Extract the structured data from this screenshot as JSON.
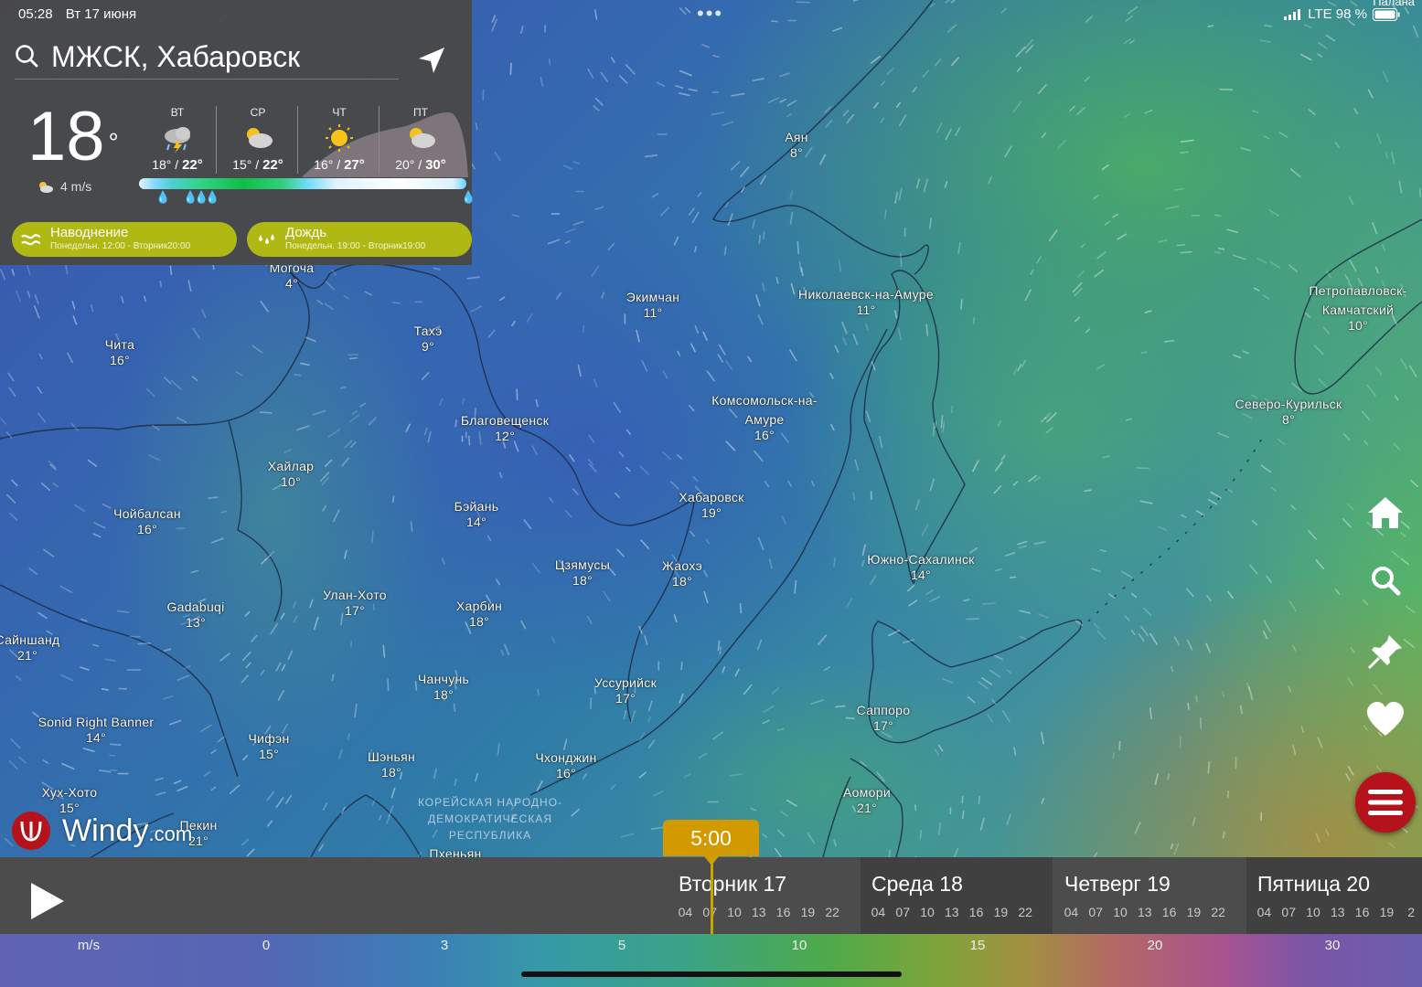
{
  "status": {
    "time": "05:28",
    "date": "Вт 17 июня",
    "network": "LTE 98 %",
    "top_right_label": "Палана"
  },
  "panel": {
    "location": "МЖСК, Хабаровск",
    "current_temp": "18",
    "degree": "°",
    "wind": "4 m/s",
    "days": [
      {
        "name": "ВТ",
        "low": "18°",
        "sep": " / ",
        "high": "22°",
        "icon": "thunderstorm-icon"
      },
      {
        "name": "СР",
        "low": "15°",
        "sep": " / ",
        "high": "22°",
        "icon": "partly-cloudy-icon"
      },
      {
        "name": "ЧТ",
        "low": "16°",
        "sep": " / ",
        "high": "27°",
        "icon": "sun-icon"
      },
      {
        "name": "ПТ",
        "low": "20°",
        "sep": " / ",
        "high": "30°",
        "icon": "partly-cloudy-icon"
      }
    ],
    "alerts": [
      {
        "title": "Наводнение",
        "period": "Понедельн. 12:00 - Вторник20:00",
        "icon": "flood-icon"
      },
      {
        "title": "Дождь",
        "period": "Понедельн. 19:00 - Вторник19:00",
        "icon": "rain-icon"
      }
    ]
  },
  "map": {
    "cities": [
      {
        "name": "Аян",
        "temp": "8°"
      },
      {
        "name": "Могоча",
        "temp": "4°"
      },
      {
        "name": "Тахэ",
        "temp": "9°"
      },
      {
        "name": "Экимчан",
        "temp": "11°"
      },
      {
        "name": "Николаевск-на-Амуре",
        "temp": "11°"
      },
      {
        "name": "Петропавловск-",
        "temp": ""
      },
      {
        "name": "Камчатский",
        "temp": "10°"
      },
      {
        "name": "Чита",
        "temp": "16°"
      },
      {
        "name": "Северо-Курильск",
        "temp": "8°"
      },
      {
        "name": "Комсомольск-на-",
        "temp": ""
      },
      {
        "name": "Амуре",
        "temp": "16°"
      },
      {
        "name": "Благовещенск",
        "temp": "12°"
      },
      {
        "name": "Хайлар",
        "temp": "10°"
      },
      {
        "name": "Бэйань",
        "temp": "14°"
      },
      {
        "name": "Хабаровск",
        "temp": "19°"
      },
      {
        "name": "Чойбалсан",
        "temp": "16°"
      },
      {
        "name": "Цзямусы",
        "temp": "18°"
      },
      {
        "name": "Жаохэ",
        "temp": "18°"
      },
      {
        "name": "Южно-Сахалинск",
        "temp": "14°"
      },
      {
        "name": "Gadabuqi",
        "temp": "13°"
      },
      {
        "name": "Улан-Хото",
        "temp": "17°"
      },
      {
        "name": "Харбин",
        "temp": "18°"
      },
      {
        "name": "Сайншанд",
        "temp": "21°"
      },
      {
        "name": "Чанчунь",
        "temp": "18°"
      },
      {
        "name": "Уссурийск",
        "temp": "17°"
      },
      {
        "name": "Саппоро",
        "temp": "17°"
      },
      {
        "name": "Sonid Right Banner",
        "temp": "14°"
      },
      {
        "name": "Чифэн",
        "temp": "15°"
      },
      {
        "name": "Шэньян",
        "temp": "18°"
      },
      {
        "name": "Чхонджин",
        "temp": "16°"
      },
      {
        "name": "Аомори",
        "temp": "21°"
      },
      {
        "name": "Хух-Хото",
        "temp": "15°"
      },
      {
        "name": "Пекин",
        "temp": "21°"
      },
      {
        "name": "Пхеньян",
        "temp": ""
      }
    ],
    "country_label": [
      "КОРЕЙСКАЯ НАРОДНО-",
      "ДЕМОКРАТИЧЕСКАЯ",
      "РЕСПУБЛИКА"
    ]
  },
  "logo": {
    "brand": "Windy",
    "suffix": ".com"
  },
  "tools": [
    "home-icon",
    "search-icon",
    "pin-icon",
    "heart-icon",
    "menu-icon"
  ],
  "timeline": {
    "current_time": "5:00",
    "days": [
      {
        "label": "Вторник 17",
        "hours": [
          "04",
          "07",
          "10",
          "13",
          "16",
          "19",
          "22"
        ]
      },
      {
        "label": "Среда 18",
        "hours": [
          "04",
          "07",
          "10",
          "13",
          "16",
          "19",
          "22"
        ]
      },
      {
        "label": "Четверг 19",
        "hours": [
          "04",
          "07",
          "10",
          "13",
          "16",
          "19",
          "22"
        ]
      },
      {
        "label": "Пятница 20",
        "hours": [
          "04",
          "07",
          "10",
          "13",
          "16",
          "19",
          "2"
        ]
      }
    ]
  },
  "legend": {
    "unit": "m/s",
    "ticks": [
      "0",
      "3",
      "5",
      "10",
      "15",
      "20",
      "30"
    ]
  }
}
